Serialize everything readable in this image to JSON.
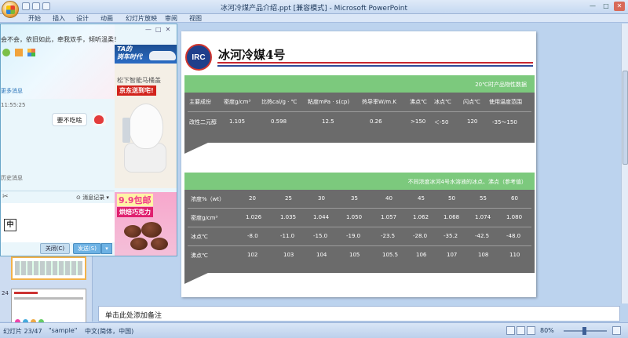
{
  "window": {
    "title": "冰河冷煤产品介绍.ppt [兼容模式] - Microsoft PowerPoint",
    "controls": [
      "—",
      "□",
      "✕"
    ]
  },
  "ribbon_tabs": [
    "开始",
    "插入",
    "设计",
    "动画",
    "幻灯片放映",
    "审阅",
    "视图"
  ],
  "thumbnails": [
    {
      "num": "",
      "kind": "grid"
    },
    {
      "num": "23",
      "kind": "table"
    },
    {
      "num": "24",
      "kind": "logo"
    }
  ],
  "slide": {
    "logo_text": "IRC",
    "title": "冰河冷媒4号",
    "table1": {
      "caption": "20℃时产品物性数据",
      "headers": [
        "主要成份",
        "密度g/cm³",
        "比热cal/g · ℃",
        "粘度mPa · s(cp)",
        "热导率W/m.K",
        "沸点℃",
        "冰点℃",
        "闪点℃",
        "使用温度范围"
      ],
      "row": [
        "改性二元醇",
        "1.105",
        "0.598",
        "12.5",
        "0.26",
        ">150",
        "＜-50",
        "120",
        "-35～150"
      ]
    },
    "table2": {
      "caption": "不同浓度冰河4号水溶液的冰点、沸点（参考值）",
      "rows": [
        {
          "label": "浓度%（wt）",
          "values": [
            "20",
            "25",
            "30",
            "35",
            "40",
            "45",
            "50",
            "55",
            "60"
          ]
        },
        {
          "label": "密度g/cm³",
          "values": [
            "1.026",
            "1.035",
            "1.044",
            "1.050",
            "1.057",
            "1.062",
            "1.068",
            "1.074",
            "1.080"
          ]
        },
        {
          "label": "冰点℃",
          "values": [
            "-8.0",
            "-11.0",
            "-15.0",
            "-19.0",
            "-23.5",
            "-28.0",
            "-35.2",
            "-42.5",
            "-48.0"
          ]
        },
        {
          "label": "沸点℃",
          "values": [
            "102",
            "103",
            "104",
            "105",
            "105.5",
            "106",
            "107",
            "108",
            "110"
          ]
        }
      ]
    }
  },
  "notes": {
    "placeholder": "单击此处添加备注"
  },
  "statusbar": {
    "slide_info": "幻灯片 23/47",
    "theme": "\"sample\"",
    "language": "中文(简体，中国)",
    "zoom": "80%"
  },
  "qq": {
    "header_text": "会不会，依旧如此，牵我双手，倾听温柔！",
    "more_messages": "更多消息",
    "time": "11:55:25",
    "message": "要不吃啥",
    "recall_hint": "历史消息",
    "history_label": "消息记录",
    "ime": "中",
    "close_label": "关闭(C)",
    "send_label": "发送(S)",
    "send_arrow": "▾",
    "win_controls": [
      "—",
      "□",
      "✕"
    ]
  },
  "ads": {
    "ad1_line1": "TA的",
    "ad1_line2": "岗车时代",
    "ad1_promo1": "松下智能马桶盖",
    "ad1_promo2": "京东送到宅!",
    "ad2_line1": "9.9包邮",
    "ad2_line2": "烘焙巧克力"
  },
  "colors": {
    "table_header_green": "#7cc97d",
    "table_body_gray": "#6b6b6b",
    "brand_red": "#c8272f",
    "brand_blue": "#2e4b9a"
  }
}
